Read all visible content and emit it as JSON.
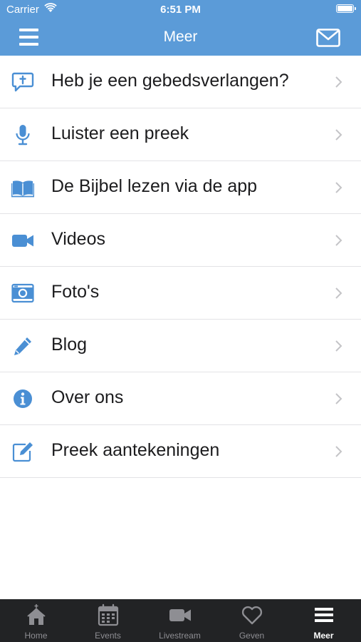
{
  "status_bar": {
    "carrier": "Carrier",
    "time": "6:51 PM"
  },
  "navbar": {
    "title": "Meer",
    "menu_icon": "hamburger-menu-icon",
    "mail_icon": "envelope-icon"
  },
  "menu_items": [
    {
      "label": "Heb je een gebedsverlangen?",
      "icon": "prayer-chat-icon"
    },
    {
      "label": "Luister een preek",
      "icon": "microphone-icon"
    },
    {
      "label": "De Bijbel lezen via de app",
      "icon": "open-book-icon"
    },
    {
      "label": "Videos",
      "icon": "video-camera-icon"
    },
    {
      "label": "Foto's",
      "icon": "camera-icon"
    },
    {
      "label": "Blog",
      "icon": "pencil-icon"
    },
    {
      "label": "Over ons",
      "icon": "info-icon"
    },
    {
      "label": "Preek aantekeningen",
      "icon": "edit-note-icon"
    }
  ],
  "tabs": [
    {
      "label": "Home",
      "icon": "church-icon",
      "active": false
    },
    {
      "label": "Events",
      "icon": "calendar-icon",
      "active": false
    },
    {
      "label": "Livestream",
      "icon": "video-camera-icon",
      "active": false
    },
    {
      "label": "Geven",
      "icon": "heart-icon",
      "active": false
    },
    {
      "label": "Meer",
      "icon": "hamburger-menu-icon",
      "active": true
    }
  ],
  "colors": {
    "header": "#5b9bd8",
    "icon_blue": "#4a8fd4",
    "tabbar": "#222325",
    "tab_inactive": "#8e8e93",
    "tab_active": "#ffffff",
    "chevron": "#c4c4c7"
  }
}
